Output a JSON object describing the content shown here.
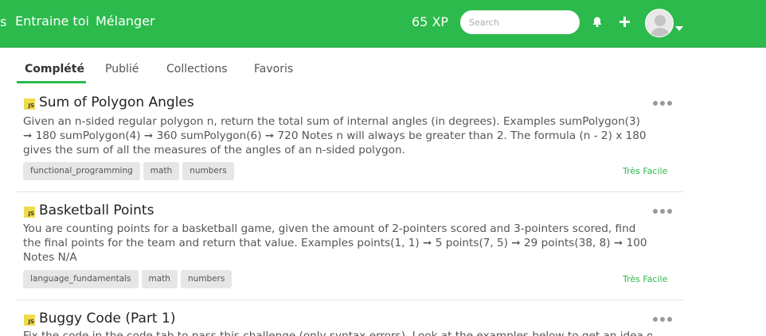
{
  "header": {
    "nav_fragment": "s",
    "nav_links": [
      "Entraine toi",
      "Mélanger"
    ],
    "xp": "65 XP",
    "search_placeholder": "Search",
    "icons": [
      "bell-icon",
      "plus-icon",
      "avatar-icon",
      "caret-down-icon"
    ]
  },
  "tabs": [
    {
      "label": "Complété",
      "active": true
    },
    {
      "label": "Publié",
      "active": false
    },
    {
      "label": "Collections",
      "active": false
    },
    {
      "label": "Favoris",
      "active": false
    }
  ],
  "challenges": [
    {
      "language_badge": "JS",
      "title": "Sum of Polygon Angles",
      "description": "Given an n-sided regular polygon n, return the total sum of internal angles (in degrees). Examples sumPolygon(3) ➞ 180 sumPolygon(4) ➞ 360 sumPolygon(6) ➞ 720 Notes n will always be greater than 2. The formula (n - 2) x 180 gives the sum of all the measures of the angles of an n-sided polygon.",
      "tags": [
        "functional_programming",
        "math",
        "numbers"
      ],
      "difficulty": "Très Facile"
    },
    {
      "language_badge": "JS",
      "title": "Basketball Points",
      "description": "You are counting points for a basketball game, given the amount of 2-pointers scored and 3-pointers scored, find the final points for the team and return that value. Examples points(1, 1) ➞ 5 points(7, 5) ➞ 29 points(38, 8) ➞ 100 Notes N/A",
      "tags": [
        "language_fundamentals",
        "math",
        "numbers"
      ],
      "difficulty": "Très Facile"
    },
    {
      "language_badge": "JS",
      "title": "Buggy Code (Part 1)",
      "description": "Fix the code in the code tab to pass this challenge (only syntax errors). Look at the examples below to get an idea of"
    }
  ],
  "colors": {
    "brand_green": "#2cba4c",
    "js_badge": "#f0db4f",
    "tag_bg": "#e6e6e6"
  }
}
